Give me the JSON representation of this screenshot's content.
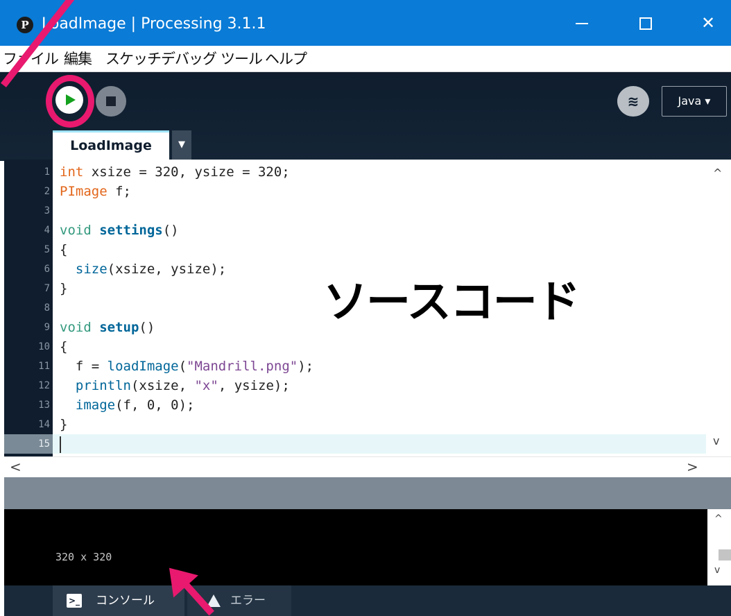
{
  "window": {
    "app_icon": "processing-logo-icon",
    "app_icon_glyph": "P",
    "title": "LoadImage | Processing 3.1.1",
    "close_glyph": "✕"
  },
  "menu": {
    "items": [
      "ファイル",
      "編集",
      "スケッチ",
      "デバッグ",
      "ツール",
      "ヘルプ"
    ]
  },
  "toolbar": {
    "run_icon": "play-icon",
    "stop_icon": "stop-icon",
    "debug_icon": "butterfly-icon",
    "debug_glyph": "≋",
    "mode": "Java ▾"
  },
  "tabs": {
    "active": "LoadImage",
    "menu_glyph": "▼"
  },
  "editor": {
    "line_numbers": [
      "1",
      "2",
      "3",
      "4",
      "5",
      "6",
      "7",
      "8",
      "9",
      "10",
      "11",
      "12",
      "13",
      "14",
      "15"
    ],
    "lines": [
      [
        {
          "t": "int",
          "c": "kw"
        },
        {
          "t": " xsize = 320, ysize = 320;",
          "c": ""
        }
      ],
      [
        {
          "t": "PImage",
          "c": "kw"
        },
        {
          "t": " f;",
          "c": ""
        }
      ],
      [],
      [
        {
          "t": "void",
          "c": "vd"
        },
        {
          "t": " ",
          "c": ""
        },
        {
          "t": "settings",
          "c": "fn"
        },
        {
          "t": "()",
          "c": ""
        }
      ],
      [
        {
          "t": "{",
          "c": ""
        }
      ],
      [
        {
          "t": "  ",
          "c": ""
        },
        {
          "t": "size",
          "c": "bi"
        },
        {
          "t": "(xsize, ysize);",
          "c": ""
        }
      ],
      [
        {
          "t": "}",
          "c": ""
        }
      ],
      [],
      [
        {
          "t": "void",
          "c": "vd"
        },
        {
          "t": " ",
          "c": ""
        },
        {
          "t": "setup",
          "c": "fn"
        },
        {
          "t": "()",
          "c": ""
        }
      ],
      [
        {
          "t": "{",
          "c": ""
        }
      ],
      [
        {
          "t": "  f = ",
          "c": ""
        },
        {
          "t": "loadImage",
          "c": "bi"
        },
        {
          "t": "(",
          "c": ""
        },
        {
          "t": "\"Mandrill.png\"",
          "c": "str"
        },
        {
          "t": ");",
          "c": ""
        }
      ],
      [
        {
          "t": "  ",
          "c": ""
        },
        {
          "t": "println",
          "c": "bi"
        },
        {
          "t": "(xsize, ",
          "c": ""
        },
        {
          "t": "\"x\"",
          "c": "str"
        },
        {
          "t": ", ysize);",
          "c": ""
        }
      ],
      [
        {
          "t": "  ",
          "c": ""
        },
        {
          "t": "image",
          "c": "bi"
        },
        {
          "t": "(f, 0, 0);",
          "c": ""
        }
      ],
      [
        {
          "t": "}",
          "c": ""
        }
      ],
      []
    ],
    "current_line": 15,
    "scroll_up": "^",
    "scroll_down": "v",
    "scroll_left": "<",
    "scroll_right": ">"
  },
  "annotation": "ソースコード",
  "console": {
    "output": "320 x 320",
    "scroll_up": "^",
    "scroll_down": "v"
  },
  "bottom_tabs": {
    "console_label": "コンソール",
    "console_icon": "terminal-icon",
    "console_glyph": ">_",
    "error_label": "エラー",
    "error_icon": "warning-icon"
  },
  "colors": {
    "highlight": "#e8196e",
    "titlebar": "#0a7bd6",
    "run_green": "#14a11e"
  }
}
